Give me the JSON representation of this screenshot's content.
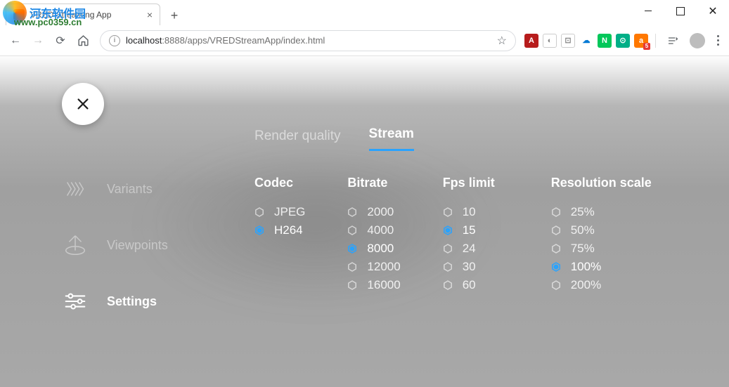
{
  "window": {
    "tab_title": "VRED Streaming App",
    "url_host": "localhost",
    "url_port": ":8888",
    "url_path": "/apps/VREDStreamApp/index.html"
  },
  "watermark": {
    "text1": "河东软件园",
    "text2": "www.pc0359.cn"
  },
  "sidebar": {
    "items": [
      {
        "label": "Variants",
        "active": false
      },
      {
        "label": "Viewpoints",
        "active": false
      },
      {
        "label": "Settings",
        "active": true
      }
    ]
  },
  "tabs": [
    {
      "label": "Render quality",
      "active": false
    },
    {
      "label": "Stream",
      "active": true
    }
  ],
  "columns": {
    "codec": {
      "title": "Codec",
      "options": [
        "JPEG",
        "H264"
      ],
      "selected": "H264"
    },
    "bitrate": {
      "title": "Bitrate",
      "options": [
        "2000",
        "4000",
        "8000",
        "12000",
        "16000"
      ],
      "selected": "8000"
    },
    "fps": {
      "title": "Fps limit",
      "options": [
        "10",
        "15",
        "24",
        "30",
        "60"
      ],
      "selected": "15"
    },
    "resolution": {
      "title": "Resolution scale",
      "options": [
        "25%",
        "50%",
        "75%",
        "100%",
        "200%"
      ],
      "selected": "100%"
    }
  }
}
